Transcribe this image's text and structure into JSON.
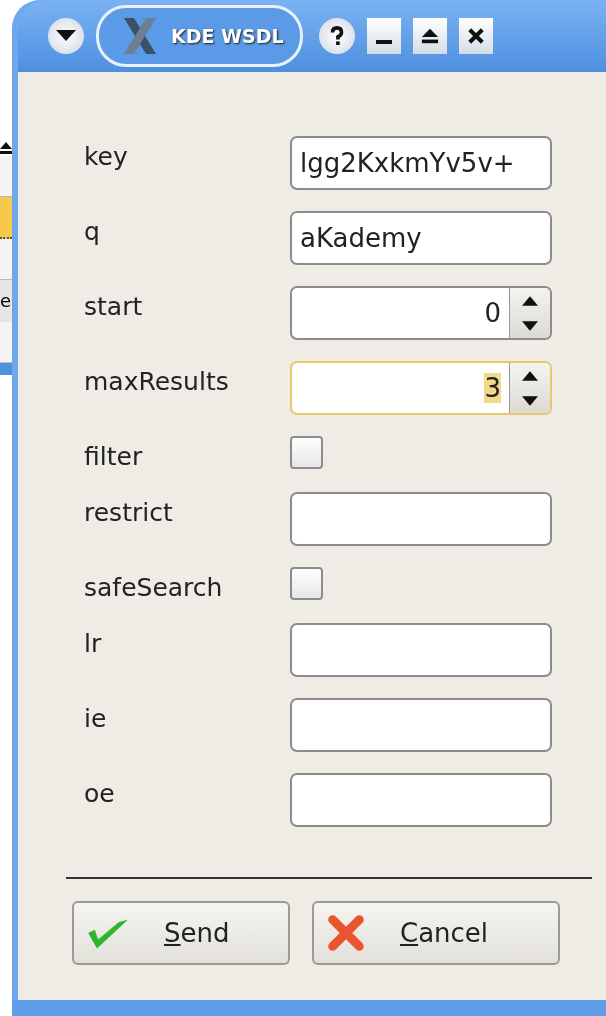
{
  "background_window": {
    "text": "e"
  },
  "window": {
    "title": "KDE WSDL"
  },
  "fields": [
    {
      "label": "key",
      "kind": "text",
      "value": "lgg2KxkmYv5v+",
      "focused": false
    },
    {
      "label": "q",
      "kind": "text",
      "value": "aKademy",
      "focused": false
    },
    {
      "label": "start",
      "kind": "spin",
      "value": "0",
      "focused": false
    },
    {
      "label": "maxResults",
      "kind": "spin",
      "value": "3",
      "focused": true
    },
    {
      "label": "filter",
      "kind": "check",
      "checked": false
    },
    {
      "label": "restrict",
      "kind": "text",
      "focused": false
    },
    {
      "label": "safeSearch",
      "kind": "check",
      "checked": false
    },
    {
      "label": "lr",
      "kind": "text",
      "focused": false
    },
    {
      "label": "ie",
      "kind": "text",
      "focused": false
    },
    {
      "label": "oe",
      "kind": "text",
      "focused": false
    }
  ],
  "buttons": [
    {
      "label": "Send",
      "kind": "ok",
      "mnemonic": true
    },
    {
      "label": "Cancel",
      "kind": "cancel",
      "mnemonic": true
    }
  ]
}
